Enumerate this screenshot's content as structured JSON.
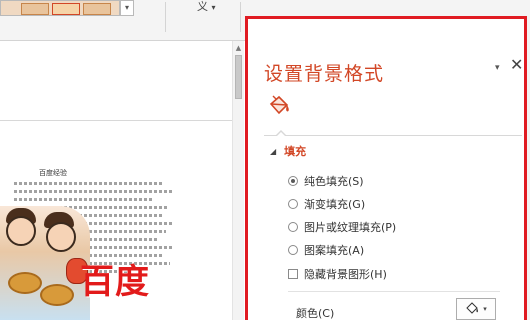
{
  "ribbon": {
    "gallery_scroll_glyph": "▾",
    "partial_button_label": "义",
    "partial_button_arrow": "▾",
    "collapse_glyph": "^"
  },
  "slide": {
    "doc_title": "百度经验",
    "watermark": "百度"
  },
  "pane": {
    "title": "设置背景格式",
    "menu_glyph": "▾",
    "close_glyph": "✕",
    "active_tab_icon": "paint-bucket-icon",
    "section": {
      "caret": "◢",
      "label": "填充"
    },
    "options": [
      {
        "label": "纯色填充(S)",
        "type": "radio",
        "selected": true
      },
      {
        "label": "渐变填充(G)",
        "type": "radio",
        "selected": false
      },
      {
        "label": "图片或纹理填充(P)",
        "type": "radio",
        "selected": false
      },
      {
        "label": "图案填充(A)",
        "type": "radio",
        "selected": false
      },
      {
        "label": "隐藏背景图形(H)",
        "type": "checkbox",
        "selected": false
      }
    ],
    "color_label": "颜色(C)",
    "color_button_arrow": "▾"
  },
  "colors": {
    "accent": "#d24726",
    "highlight_box": "#e01b22",
    "watermark": "#e21b1b"
  }
}
